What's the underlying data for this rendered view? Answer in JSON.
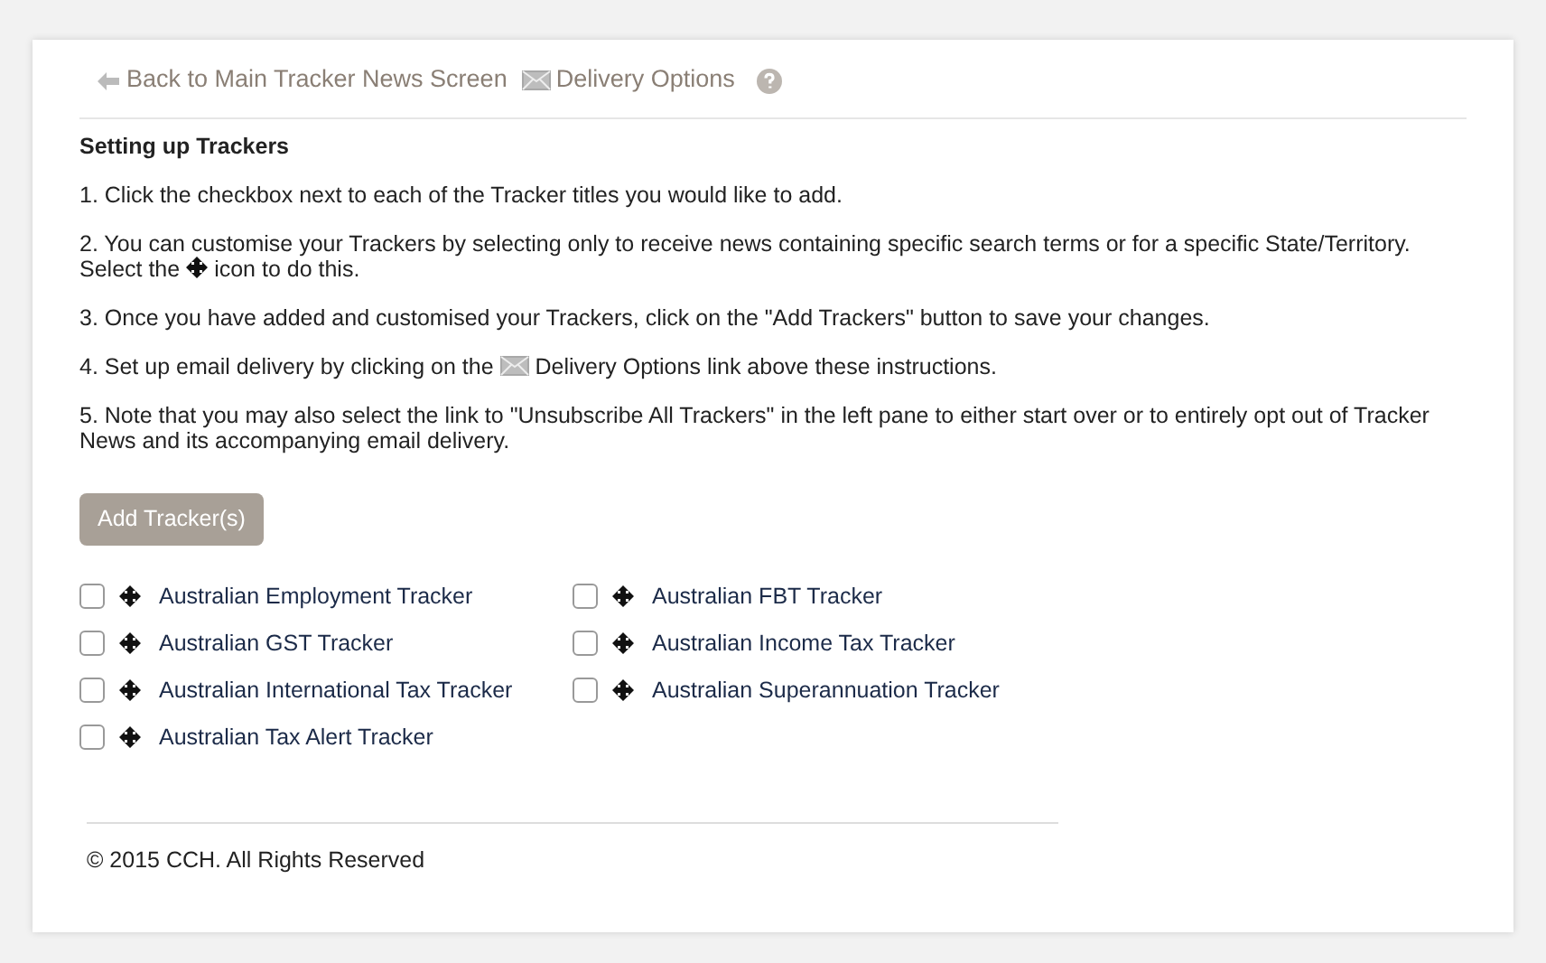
{
  "nav": {
    "back_link": "Back to Main Tracker News Screen",
    "delivery_link": "Delivery Options"
  },
  "heading": "Setting up Trackers",
  "instructions": [
    {
      "kind": "plain",
      "text": "1. Click the checkbox next to each of the Tracker titles you would like to add."
    },
    {
      "kind": "move",
      "text": "2. You can customise your Trackers by selecting only to receive news containing specific search terms or for a specific State/Territory. Select the",
      "text_after": "icon to do this."
    },
    {
      "kind": "plain",
      "text": "3. Once you have added and customised your Trackers, click on the \"Add Trackers\" button to save your changes."
    },
    {
      "kind": "mail",
      "text": "4. Set up email delivery by clicking on the",
      "text_after": "Delivery Options link above these instructions."
    },
    {
      "kind": "plain",
      "text": "5. Note that you may also select the link to \"Unsubscribe All Trackers\" in the left pane to either start over or to entirely opt out of Tracker News and its accompanying email delivery."
    }
  ],
  "add_button": "Add Tracker(s)",
  "trackers": [
    {
      "label": "Australian Employment Tracker",
      "checked": false
    },
    {
      "label": "Australian FBT Tracker",
      "checked": false
    },
    {
      "label": "Australian GST Tracker",
      "checked": false
    },
    {
      "label": "Australian Income Tax Tracker",
      "checked": false
    },
    {
      "label": "Australian International Tax Tracker",
      "checked": false
    },
    {
      "label": "Australian Superannuation Tracker",
      "checked": false
    },
    {
      "label": "Australian Tax Alert Tracker",
      "checked": false
    }
  ],
  "footer": "© 2015 CCH. All Rights Reserved"
}
